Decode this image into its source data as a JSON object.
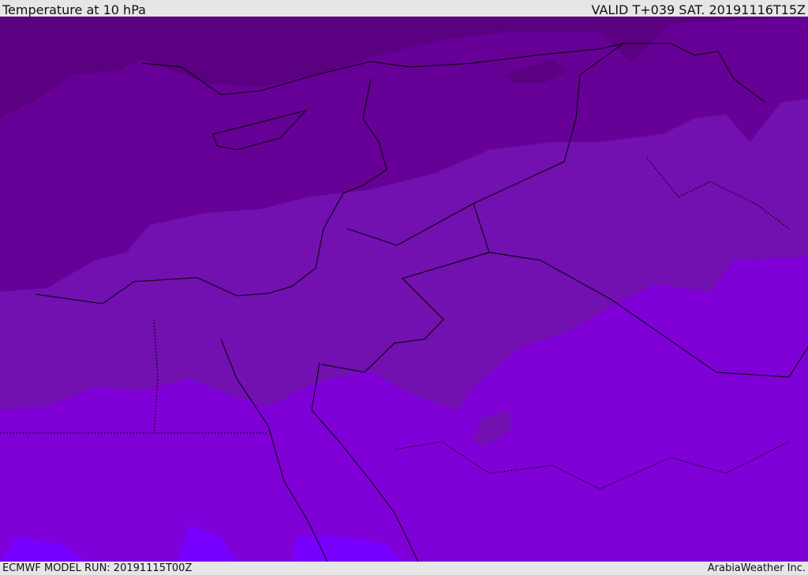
{
  "header": {
    "title": "Temperature at 10 hPa",
    "valid": "VALID T+039 SAT. 20191116T15Z"
  },
  "footer": {
    "model_run": "ECMWF MODEL RUN: 20191115T00Z",
    "credit": "ArabiaWeather Inc."
  },
  "colors": {
    "band1": "#5a0080",
    "band2": "#670096",
    "band3": "#7210b0",
    "band4": "#8000d8",
    "band5": "#7800ff",
    "border": "#000000"
  }
}
